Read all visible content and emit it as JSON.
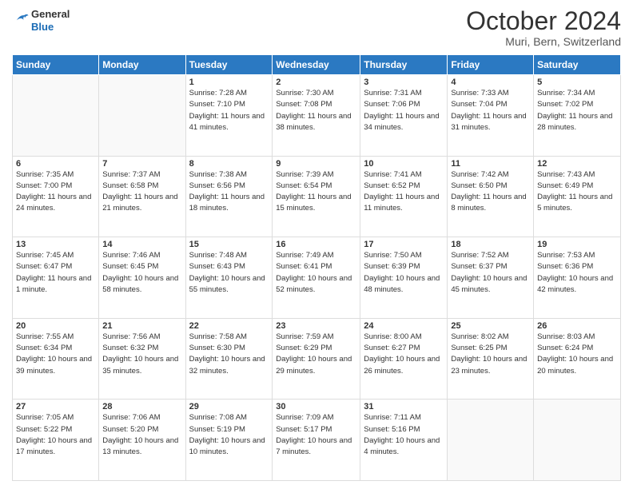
{
  "header": {
    "logo": {
      "general": "General",
      "blue": "Blue"
    },
    "title": "October 2024",
    "location": "Muri, Bern, Switzerland"
  },
  "days_of_week": [
    "Sunday",
    "Monday",
    "Tuesday",
    "Wednesday",
    "Thursday",
    "Friday",
    "Saturday"
  ],
  "weeks": [
    [
      {
        "day": "",
        "info": ""
      },
      {
        "day": "",
        "info": ""
      },
      {
        "day": "1",
        "sunrise": "Sunrise: 7:28 AM",
        "sunset": "Sunset: 7:10 PM",
        "daylight": "Daylight: 11 hours and 41 minutes."
      },
      {
        "day": "2",
        "sunrise": "Sunrise: 7:30 AM",
        "sunset": "Sunset: 7:08 PM",
        "daylight": "Daylight: 11 hours and 38 minutes."
      },
      {
        "day": "3",
        "sunrise": "Sunrise: 7:31 AM",
        "sunset": "Sunset: 7:06 PM",
        "daylight": "Daylight: 11 hours and 34 minutes."
      },
      {
        "day": "4",
        "sunrise": "Sunrise: 7:33 AM",
        "sunset": "Sunset: 7:04 PM",
        "daylight": "Daylight: 11 hours and 31 minutes."
      },
      {
        "day": "5",
        "sunrise": "Sunrise: 7:34 AM",
        "sunset": "Sunset: 7:02 PM",
        "daylight": "Daylight: 11 hours and 28 minutes."
      }
    ],
    [
      {
        "day": "6",
        "sunrise": "Sunrise: 7:35 AM",
        "sunset": "Sunset: 7:00 PM",
        "daylight": "Daylight: 11 hours and 24 minutes."
      },
      {
        "day": "7",
        "sunrise": "Sunrise: 7:37 AM",
        "sunset": "Sunset: 6:58 PM",
        "daylight": "Daylight: 11 hours and 21 minutes."
      },
      {
        "day": "8",
        "sunrise": "Sunrise: 7:38 AM",
        "sunset": "Sunset: 6:56 PM",
        "daylight": "Daylight: 11 hours and 18 minutes."
      },
      {
        "day": "9",
        "sunrise": "Sunrise: 7:39 AM",
        "sunset": "Sunset: 6:54 PM",
        "daylight": "Daylight: 11 hours and 15 minutes."
      },
      {
        "day": "10",
        "sunrise": "Sunrise: 7:41 AM",
        "sunset": "Sunset: 6:52 PM",
        "daylight": "Daylight: 11 hours and 11 minutes."
      },
      {
        "day": "11",
        "sunrise": "Sunrise: 7:42 AM",
        "sunset": "Sunset: 6:50 PM",
        "daylight": "Daylight: 11 hours and 8 minutes."
      },
      {
        "day": "12",
        "sunrise": "Sunrise: 7:43 AM",
        "sunset": "Sunset: 6:49 PM",
        "daylight": "Daylight: 11 hours and 5 minutes."
      }
    ],
    [
      {
        "day": "13",
        "sunrise": "Sunrise: 7:45 AM",
        "sunset": "Sunset: 6:47 PM",
        "daylight": "Daylight: 11 hours and 1 minute."
      },
      {
        "day": "14",
        "sunrise": "Sunrise: 7:46 AM",
        "sunset": "Sunset: 6:45 PM",
        "daylight": "Daylight: 10 hours and 58 minutes."
      },
      {
        "day": "15",
        "sunrise": "Sunrise: 7:48 AM",
        "sunset": "Sunset: 6:43 PM",
        "daylight": "Daylight: 10 hours and 55 minutes."
      },
      {
        "day": "16",
        "sunrise": "Sunrise: 7:49 AM",
        "sunset": "Sunset: 6:41 PM",
        "daylight": "Daylight: 10 hours and 52 minutes."
      },
      {
        "day": "17",
        "sunrise": "Sunrise: 7:50 AM",
        "sunset": "Sunset: 6:39 PM",
        "daylight": "Daylight: 10 hours and 48 minutes."
      },
      {
        "day": "18",
        "sunrise": "Sunrise: 7:52 AM",
        "sunset": "Sunset: 6:37 PM",
        "daylight": "Daylight: 10 hours and 45 minutes."
      },
      {
        "day": "19",
        "sunrise": "Sunrise: 7:53 AM",
        "sunset": "Sunset: 6:36 PM",
        "daylight": "Daylight: 10 hours and 42 minutes."
      }
    ],
    [
      {
        "day": "20",
        "sunrise": "Sunrise: 7:55 AM",
        "sunset": "Sunset: 6:34 PM",
        "daylight": "Daylight: 10 hours and 39 minutes."
      },
      {
        "day": "21",
        "sunrise": "Sunrise: 7:56 AM",
        "sunset": "Sunset: 6:32 PM",
        "daylight": "Daylight: 10 hours and 35 minutes."
      },
      {
        "day": "22",
        "sunrise": "Sunrise: 7:58 AM",
        "sunset": "Sunset: 6:30 PM",
        "daylight": "Daylight: 10 hours and 32 minutes."
      },
      {
        "day": "23",
        "sunrise": "Sunrise: 7:59 AM",
        "sunset": "Sunset: 6:29 PM",
        "daylight": "Daylight: 10 hours and 29 minutes."
      },
      {
        "day": "24",
        "sunrise": "Sunrise: 8:00 AM",
        "sunset": "Sunset: 6:27 PM",
        "daylight": "Daylight: 10 hours and 26 minutes."
      },
      {
        "day": "25",
        "sunrise": "Sunrise: 8:02 AM",
        "sunset": "Sunset: 6:25 PM",
        "daylight": "Daylight: 10 hours and 23 minutes."
      },
      {
        "day": "26",
        "sunrise": "Sunrise: 8:03 AM",
        "sunset": "Sunset: 6:24 PM",
        "daylight": "Daylight: 10 hours and 20 minutes."
      }
    ],
    [
      {
        "day": "27",
        "sunrise": "Sunrise: 7:05 AM",
        "sunset": "Sunset: 5:22 PM",
        "daylight": "Daylight: 10 hours and 17 minutes."
      },
      {
        "day": "28",
        "sunrise": "Sunrise: 7:06 AM",
        "sunset": "Sunset: 5:20 PM",
        "daylight": "Daylight: 10 hours and 13 minutes."
      },
      {
        "day": "29",
        "sunrise": "Sunrise: 7:08 AM",
        "sunset": "Sunset: 5:19 PM",
        "daylight": "Daylight: 10 hours and 10 minutes."
      },
      {
        "day": "30",
        "sunrise": "Sunrise: 7:09 AM",
        "sunset": "Sunset: 5:17 PM",
        "daylight": "Daylight: 10 hours and 7 minutes."
      },
      {
        "day": "31",
        "sunrise": "Sunrise: 7:11 AM",
        "sunset": "Sunset: 5:16 PM",
        "daylight": "Daylight: 10 hours and 4 minutes."
      },
      {
        "day": "",
        "info": ""
      },
      {
        "day": "",
        "info": ""
      }
    ]
  ]
}
